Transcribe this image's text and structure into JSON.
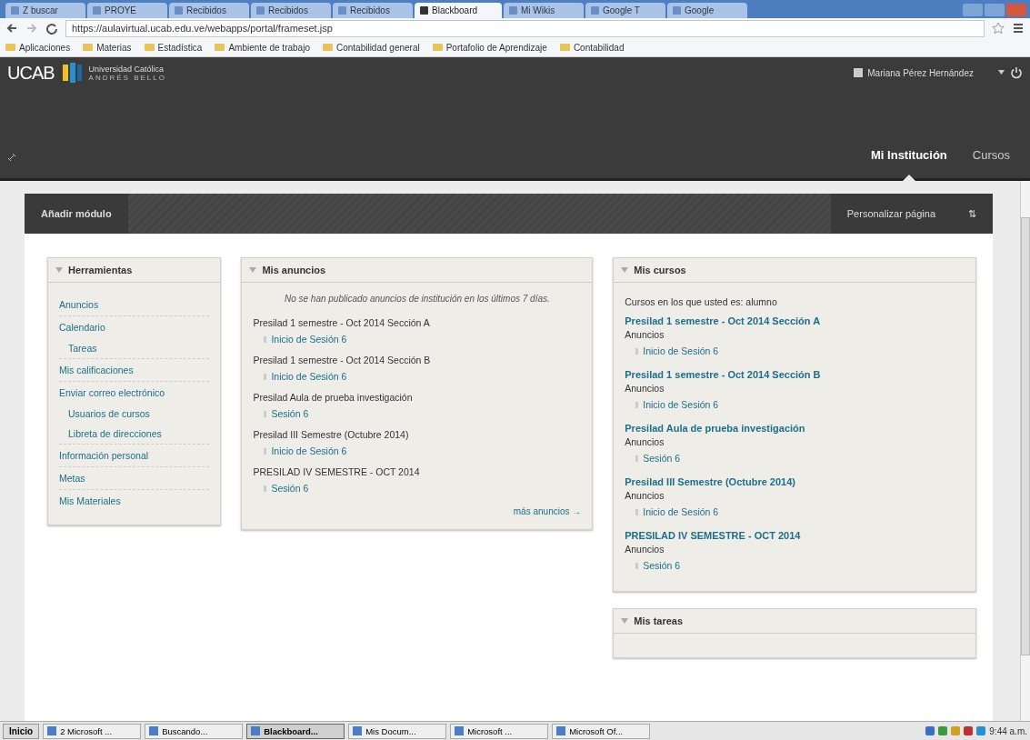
{
  "browser": {
    "tabs": [
      {
        "label": "Z buscar",
        "selected": false
      },
      {
        "label": "PROYE",
        "selected": false
      },
      {
        "label": "Recibidos",
        "selected": false
      },
      {
        "label": "Recibidos",
        "selected": false
      },
      {
        "label": "Recibidos",
        "selected": false
      },
      {
        "label": "Blackboard",
        "selected": true
      },
      {
        "label": "Mi Wikis",
        "selected": false
      },
      {
        "label": "Google T",
        "selected": false
      },
      {
        "label": "Google",
        "selected": false
      }
    ],
    "url": "https://aulavirtual.ucab.edu.ve/webapps/portal/frameset.jsp",
    "bookmarks": [
      "Aplicaciones",
      "Materias",
      "Estadística",
      "Ambiente de trabajo",
      "Contabilidad general",
      "Portafolio de Aprendizaje",
      "Contabilidad"
    ]
  },
  "header": {
    "logo": "UCAB",
    "university": "Universidad Católica",
    "university_sub": "ANDRÉS BELLO",
    "user": "Mariana Pérez Hernández",
    "nav": [
      {
        "label": "Mi Institución",
        "selected": true
      },
      {
        "label": "Cursos",
        "selected": false
      }
    ]
  },
  "module_bar": {
    "add": "Añadir módulo",
    "customize": "Personalizar página",
    "sort_icon": "⇅"
  },
  "tools": {
    "title": "Herramientas",
    "items": [
      {
        "label": "Anuncios"
      },
      {
        "label": "Calendario",
        "children": [
          {
            "label": "Tareas"
          }
        ]
      },
      {
        "label": "Mis calificaciones"
      },
      {
        "label": "Enviar correo electrónico",
        "children": [
          {
            "label": "Usuarios de cursos"
          },
          {
            "label": "Libreta de direcciones"
          }
        ]
      },
      {
        "label": "Información personal"
      },
      {
        "label": "Metas"
      },
      {
        "label": "Mis Materiales"
      }
    ]
  },
  "announcements": {
    "title": "Mis anuncios",
    "notice": "No se han publicado anuncios de institución en los últimos 7 días.",
    "groups": [
      {
        "course": "Presilad 1 semestre - Oct 2014 Sección A",
        "item": "Inicio de Sesión 6"
      },
      {
        "course": "Presilad 1 semestre - Oct 2014 Sección B",
        "item": "Inicio de Sesión 6"
      },
      {
        "course": "Presilad Aula de prueba investigación",
        "item": "Sesión 6"
      },
      {
        "course": "Presilad III Semestre (Octubre 2014)",
        "item": "Inicio de Sesión 6"
      },
      {
        "course": "PRESILAD IV SEMESTRE - OCT 2014",
        "item": "Sesión 6"
      }
    ],
    "more": "más anuncios →"
  },
  "courses": {
    "title": "Mis cursos",
    "intro": "Cursos en los que usted es: alumno",
    "list": [
      {
        "name": "Presilad 1 semestre - Oct 2014 Sección A",
        "label": "Anuncios",
        "item": "Inicio de Sesión 6"
      },
      {
        "name": "Presilad 1 semestre - Oct 2014 Sección B",
        "label": "Anuncios",
        "item": "Inicio de Sesión 6"
      },
      {
        "name": "Presilad Aula de prueba investigación",
        "label": "Anuncios",
        "item": "Sesión 6"
      },
      {
        "name": "Presilad III Semestre (Octubre 2014)",
        "label": "Anuncios",
        "item": "Inicio de Sesión 6"
      },
      {
        "name": "PRESILAD IV SEMESTRE - OCT 2014",
        "label": "Anuncios",
        "item": "Sesión 6"
      }
    ]
  },
  "tasks": {
    "title": "Mis tareas"
  },
  "taskbar": {
    "start": "Inicio",
    "items": [
      {
        "label": "2 Microsoft ...",
        "selected": false
      },
      {
        "label": "Buscando...",
        "selected": false
      },
      {
        "label": "Blackboard...",
        "selected": true
      },
      {
        "label": "Mis Docum...",
        "selected": false
      },
      {
        "label": "Microsoft ...",
        "selected": false
      },
      {
        "label": "Microsoft Of...",
        "selected": false
      }
    ],
    "clock": "9:44 a.m."
  }
}
